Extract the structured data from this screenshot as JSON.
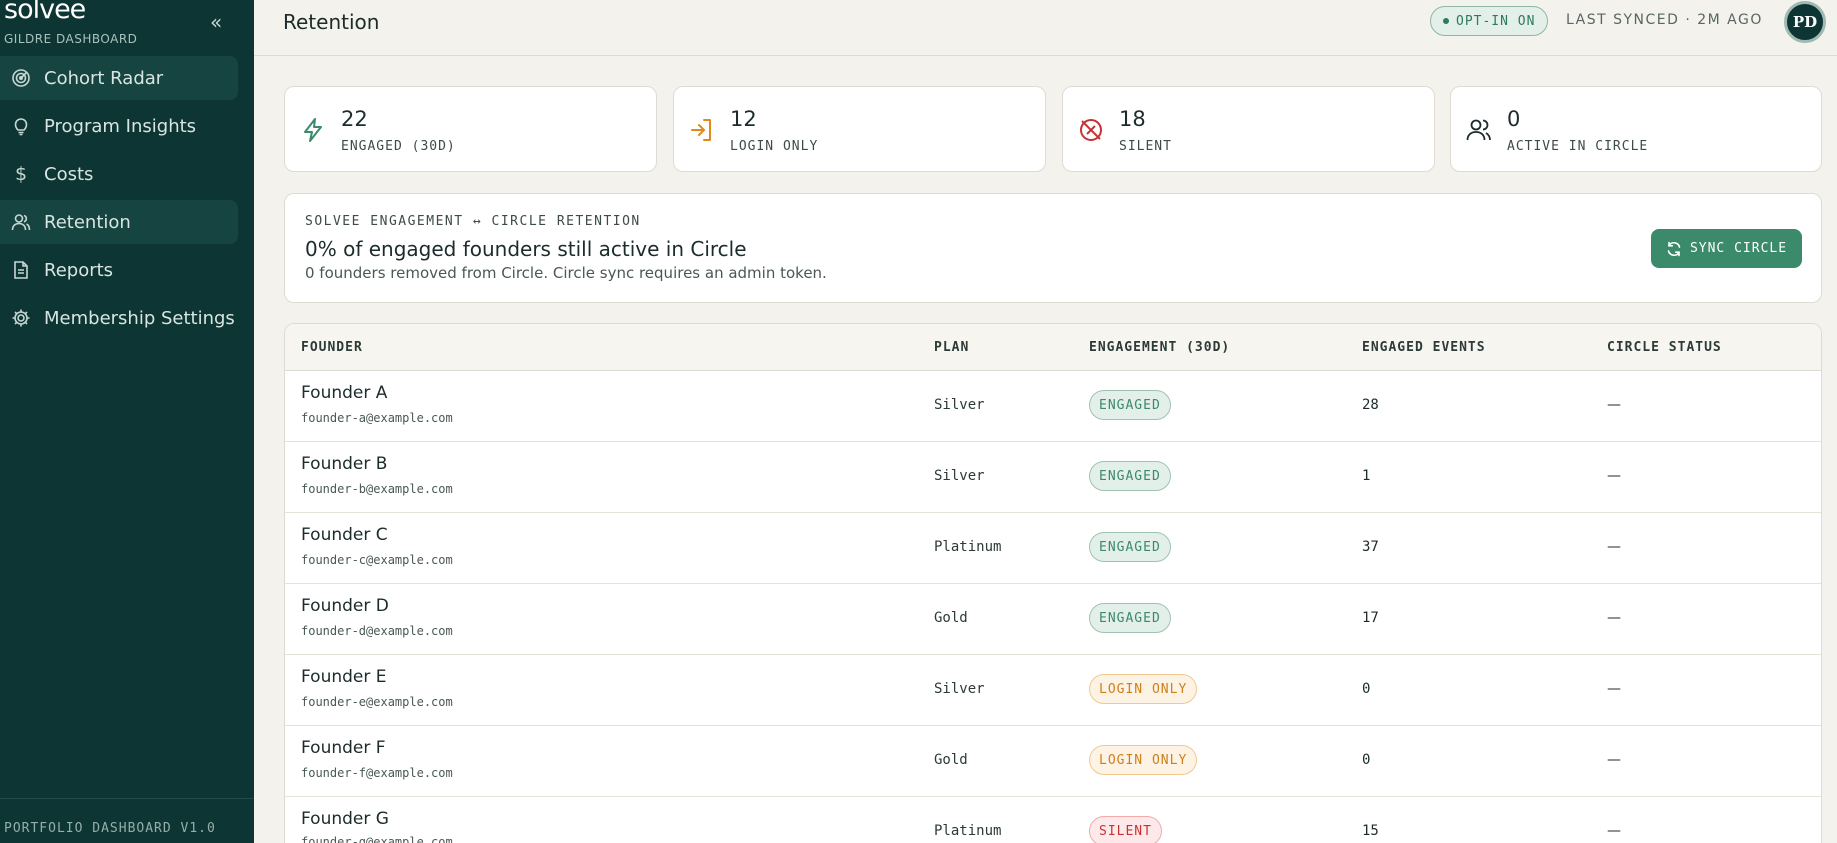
{
  "sidebar": {
    "brand": "solvee",
    "subtitle": "GILDRE DASHBOARD",
    "collapse_icon": "double-chevron-left-icon",
    "items": [
      {
        "label": "Cohort Radar",
        "icon": "radar-icon"
      },
      {
        "label": "Program Insights",
        "icon": "lightbulb-icon"
      },
      {
        "label": "Costs",
        "icon": "dollar-icon"
      },
      {
        "label": "Retention",
        "icon": "users-icon",
        "active": true
      },
      {
        "label": "Reports",
        "icon": "document-icon"
      },
      {
        "label": "Membership Settings",
        "icon": "gear-icon"
      }
    ],
    "footer": "PORTFOLIO DASHBOARD V1.0"
  },
  "header": {
    "title": "Retention",
    "optin": "OPT-IN ON",
    "synced": "LAST SYNCED · 2M AGO",
    "avatar": "PD"
  },
  "stats": [
    {
      "value": "22",
      "label": "ENGAGED (30D)",
      "icon": "lightning-icon",
      "color": "#3b8a6b"
    },
    {
      "value": "12",
      "label": "LOGIN ONLY",
      "icon": "login-arrow-icon",
      "color": "#e08a1e"
    },
    {
      "value": "18",
      "label": "SILENT",
      "icon": "blocked-icon",
      "color": "#c83232"
    },
    {
      "value": "0",
      "label": "ACTIVE IN CIRCLE",
      "icon": "users-icon",
      "color": "#1c2b2b"
    }
  ],
  "banner": {
    "kicker": "SOLVEE ENGAGEMENT ↔ CIRCLE RETENTION",
    "headline": "0% of engaged founders still active in Circle",
    "sub": "0 founders removed from Circle. Circle sync requires an admin token.",
    "button": "SYNC CIRCLE"
  },
  "table": {
    "columns": [
      "FOUNDER",
      "PLAN",
      "ENGAGEMENT (30D)",
      "ENGAGED EVENTS",
      "CIRCLE STATUS"
    ],
    "rows": [
      {
        "name": "Founder A",
        "email": "founder-a@example.com",
        "plan": "Silver",
        "engagement": "ENGAGED",
        "events": "28",
        "circle": "—"
      },
      {
        "name": "Founder B",
        "email": "founder-b@example.com",
        "plan": "Silver",
        "engagement": "ENGAGED",
        "events": "1",
        "circle": "—"
      },
      {
        "name": "Founder C",
        "email": "founder-c@example.com",
        "plan": "Platinum",
        "engagement": "ENGAGED",
        "events": "37",
        "circle": "—"
      },
      {
        "name": "Founder D",
        "email": "founder-d@example.com",
        "plan": "Gold",
        "engagement": "ENGAGED",
        "events": "17",
        "circle": "—"
      },
      {
        "name": "Founder E",
        "email": "founder-e@example.com",
        "plan": "Silver",
        "engagement": "LOGIN ONLY",
        "events": "0",
        "circle": "—"
      },
      {
        "name": "Founder F",
        "email": "founder-f@example.com",
        "plan": "Gold",
        "engagement": "LOGIN ONLY",
        "events": "0",
        "circle": "—"
      },
      {
        "name": "Founder G",
        "email": "founder-g@example.com",
        "plan": "Platinum",
        "engagement": "SILENT",
        "events": "15",
        "circle": "—"
      }
    ]
  }
}
